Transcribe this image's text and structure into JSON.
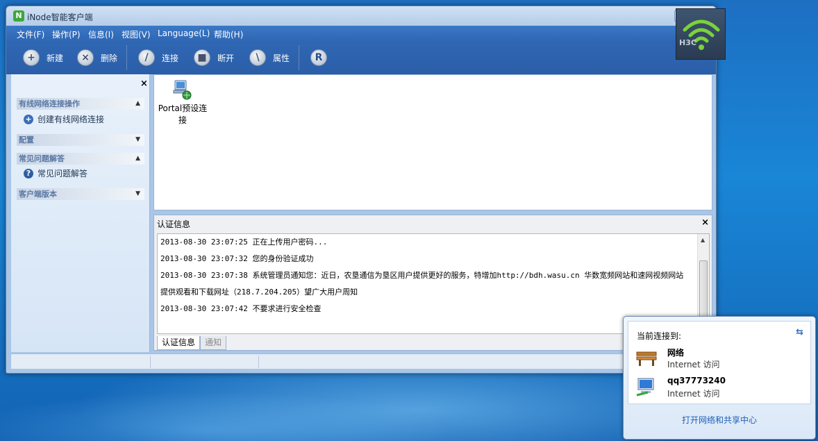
{
  "window": {
    "title": "iNode智能客户端",
    "logo_letter": "N",
    "buttons": {
      "minimize": "_",
      "maximize": "□",
      "close": "×"
    }
  },
  "menubar": {
    "items": [
      "文件(F)",
      "操作(P)",
      "信息(I)",
      "视图(V)",
      "Language(L)",
      "帮助(H)"
    ]
  },
  "toolbar": {
    "new_label": "新建",
    "delete_label": "删除",
    "connect_label": "连接",
    "disconnect_label": "断开",
    "properties_label": "属性",
    "r_label": "R",
    "brand_text": "H3C"
  },
  "left_panel": {
    "close_glyph": "×",
    "sections": [
      {
        "header": "有线网络连接操作",
        "chevron": "▲",
        "item": "创建有线网络连接"
      },
      {
        "header": "配置",
        "chevron": "▼"
      },
      {
        "header": "常见问题解答",
        "chevron": "▲",
        "item": "常见问题解答"
      },
      {
        "header": "客户端版本",
        "chevron": "▼"
      }
    ]
  },
  "connections": {
    "items": [
      {
        "label": "Portal预设连接"
      }
    ]
  },
  "auth_panel": {
    "title": "认证信息",
    "close_glyph": "×",
    "log_lines": [
      "2013-08-30 23:07:25 正在上传用户密码...",
      "2013-08-30 23:07:32 您的身份验证成功",
      "2013-08-30 23:07:38 系统管理员通知您：近日，农垦通信为垦区用户提供更好的服务，特增加http://bdh.wasu.cn 华数宽频网站和速网视频网站",
      "提供观看和下载网址（218.7.204.205）望广大用户周知",
      "2013-08-30 23:07:42 不要求进行安全检查"
    ],
    "tabs": [
      "认证信息",
      "通知"
    ],
    "scroll": {
      "up": "▲",
      "down": "▼"
    }
  },
  "network_popup": {
    "heading": "当前连接到:",
    "refresh_glyph": "⇆",
    "networks": [
      {
        "name": "网络",
        "status": "Internet 访问"
      },
      {
        "name": "qq37773240",
        "status": "Internet 访问"
      }
    ],
    "link": "打开网络和共享中心"
  },
  "colors": {
    "desktop": "#1a86d6",
    "titlebar": "#b4cde9",
    "menubar": "#2f67b4",
    "link": "#1f5fb8"
  }
}
